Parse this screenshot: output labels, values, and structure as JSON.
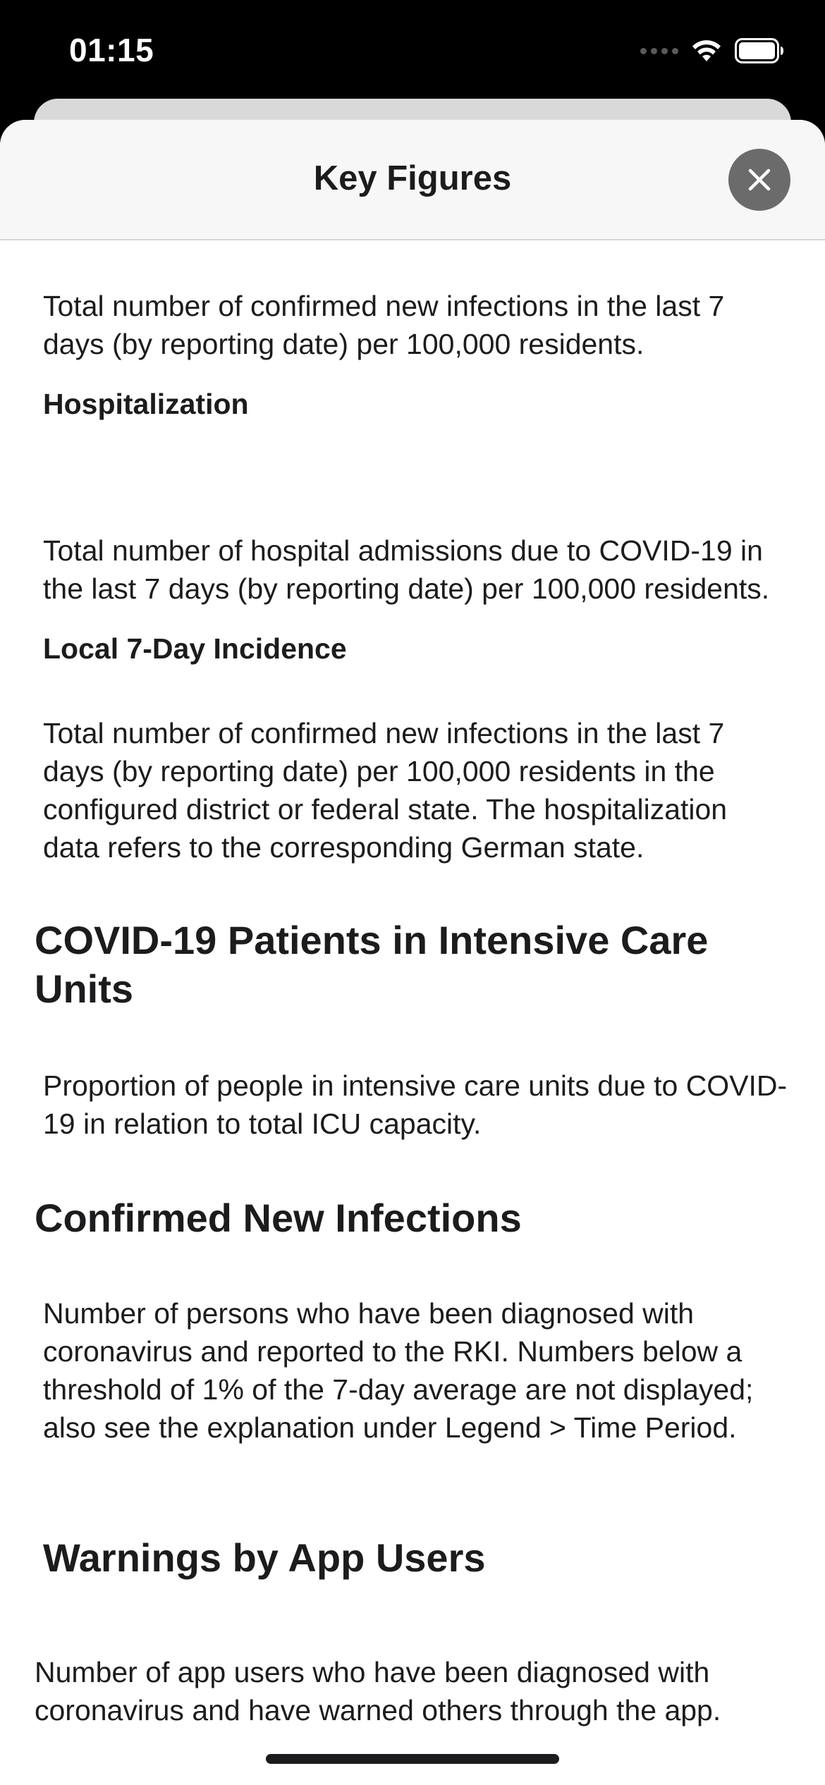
{
  "status_bar": {
    "time": "01:15"
  },
  "sheet": {
    "title": "Key Figures",
    "close_icon": "close-icon"
  },
  "content": {
    "para_incidence_continued": "Total number of confirmed new infections in the last 7 days (by reporting date) per 100,000 residents.",
    "hospitalization_title": "Hospitalization",
    "hospitalization_text": "Total number of hospital admissions due to COVID-19 in the last 7 days (by reporting date) per 100,000 residents.",
    "local_incidence_title": "Local 7-Day Incidence",
    "local_incidence_text": "Total number of confirmed new infections in the last 7 days (by reporting date) per 100,000 residents in the configured district or federal state. The hospitalization data refers to the corresponding German state.",
    "icu_title": "COVID-19 Patients in Intensive Care Units",
    "icu_text": "Proportion of people in intensive care units due to COVID-19 in relation to total ICU capacity.",
    "new_infections_title": "Confirmed New Infections",
    "new_infections_text": "Number of persons who have been diagnosed with coronavirus and reported to the RKI. Numbers below a threshold of 1% of the 7-day average are not displayed; also see the explanation under Legend > Time Period.",
    "warnings_title": "Warnings by App Users",
    "warnings_text": "Number of app users who have been diagnosed with coronavirus and have warned others through the app."
  }
}
